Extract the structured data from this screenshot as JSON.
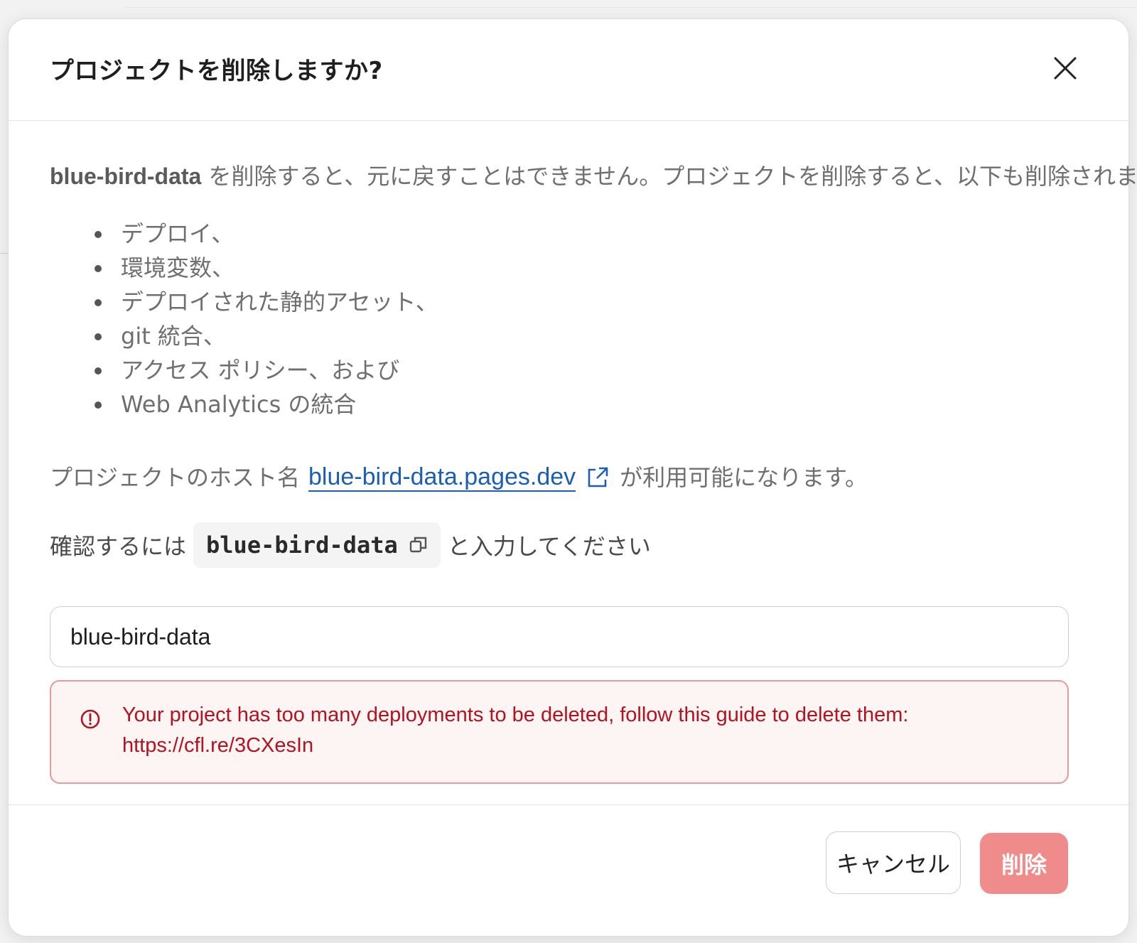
{
  "dialog": {
    "title": "プロジェクトを削除しますか?",
    "close_icon": "close-icon"
  },
  "body": {
    "project_name": "blue-bird-data",
    "description_rest": " を削除すると、元に戻すことはできません。プロジェクトを削除すると、以下も削除されます。",
    "items": [
      {
        "label": "デプロイ、"
      },
      {
        "label": "環境変数、"
      },
      {
        "label": "デプロイされた静的アセット、"
      },
      {
        "label": "git 統合、"
      },
      {
        "label": "アクセス ポリシー、および"
      },
      {
        "label": "Web Analytics の統合"
      }
    ],
    "hostname_prefix": "プロジェクトのホスト名",
    "hostname_link": "blue-bird-data.pages.dev",
    "hostname_suffix": "が利用可能になります。",
    "external_link_icon": "external-link-icon",
    "confirm_prefix": "確認するには",
    "confirm_code": "blue-bird-data",
    "copy_icon": "copy-icon",
    "confirm_suffix": "と入力してください",
    "input_value": "blue-bird-data"
  },
  "error": {
    "icon": "alert-circle-icon",
    "message": "Your project has too many deployments to be deleted, follow this guide to delete them:",
    "url": "https://cfl.re/3CXesIn",
    "color": "#b3121f"
  },
  "footer": {
    "cancel_label": "キャンセル",
    "delete_label": "削除",
    "delete_color": "#ee7f7f"
  }
}
